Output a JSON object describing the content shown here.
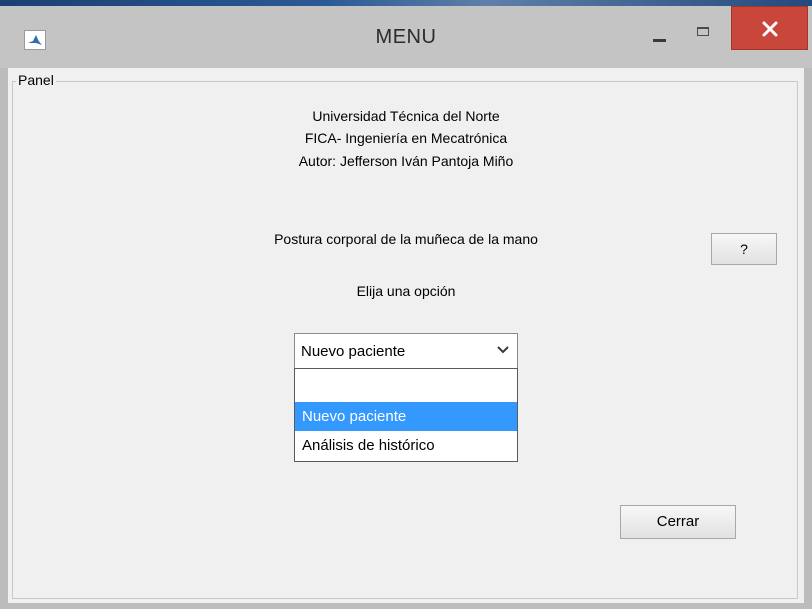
{
  "window": {
    "title": "MENU"
  },
  "panel": {
    "label": "Panel",
    "institution": "Universidad Técnica del Norte",
    "faculty": "FICA- Ingeniería en Mecatrónica",
    "author": "Autor: Jefferson Iván Pantoja Miño",
    "subject": "Postura corporal  de la muñeca de la mano",
    "prompt": "Elija una opción",
    "help_label": "?",
    "close_label": "Cerrar"
  },
  "select": {
    "value": "Nuevo paciente",
    "options": [
      "",
      "Nuevo paciente",
      "Análisis de histórico"
    ],
    "selected_index": 1
  },
  "colors": {
    "highlight": "#3399ff",
    "close_button": "#c9463a"
  }
}
